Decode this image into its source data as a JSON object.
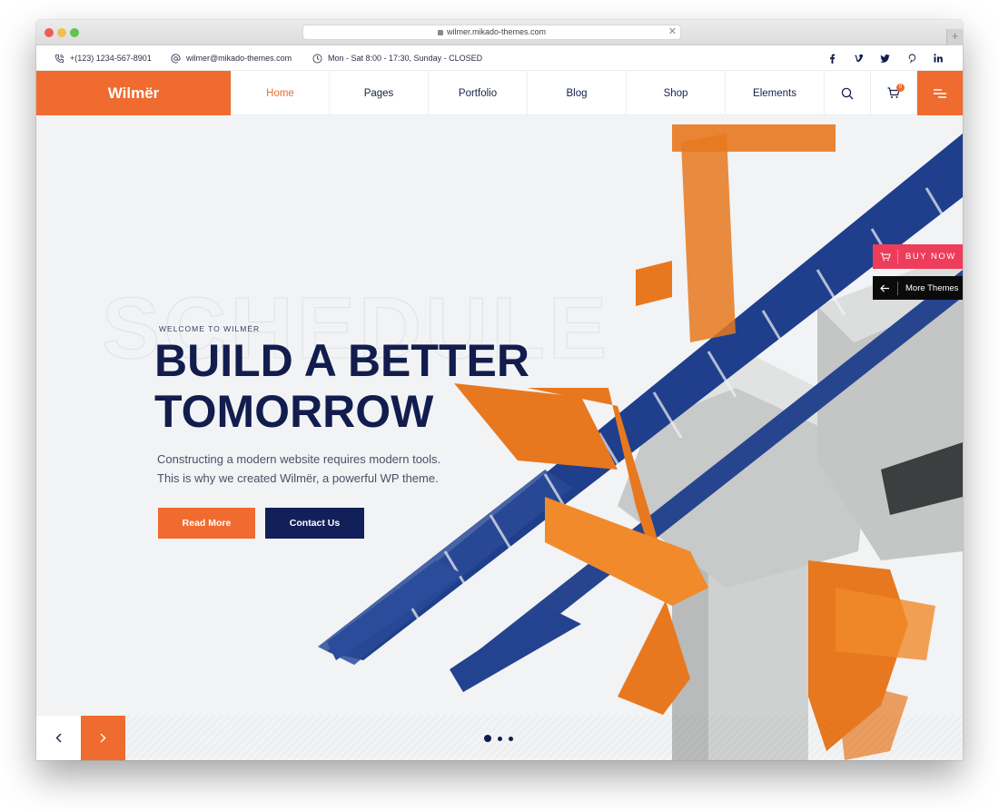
{
  "browser": {
    "url": "wilmer.mikado-themes.com",
    "new_tab_label": "+"
  },
  "topbar": {
    "phone": "+(123) 1234-567-8901",
    "email": "wilmer@mikado-themes.com",
    "hours": "Mon - Sat 8:00 - 17:30, Sunday - CLOSED",
    "social": [
      {
        "name": "facebook",
        "glyph": "f"
      },
      {
        "name": "vimeo",
        "glyph": "v"
      },
      {
        "name": "twitter",
        "glyph": "t"
      },
      {
        "name": "pinterest",
        "glyph": "p"
      },
      {
        "name": "linkedin",
        "glyph": "in"
      }
    ]
  },
  "nav": {
    "logo": "Wilmër",
    "items": [
      {
        "label": "Home",
        "active": true
      },
      {
        "label": "Pages"
      },
      {
        "label": "Portfolio"
      },
      {
        "label": "Blog"
      },
      {
        "label": "Shop"
      },
      {
        "label": "Elements"
      }
    ],
    "cart_count": "0"
  },
  "hero": {
    "background_word": "SCHEDULE",
    "eyebrow": "WELCOME TO WILMËR",
    "headline_line1": "BUILD A BETTER",
    "headline_line2": "TOMORROW",
    "sub_line1": "Constructing a modern website requires modern tools.",
    "sub_line2": "This is why we created Wilmër, a powerful WP theme.",
    "read_more": "Read More",
    "contact_us": "Contact Us",
    "slides": 3,
    "active_slide": 1
  },
  "side_buttons": {
    "buy_now": "BUY NOW",
    "more_themes": "More Themes"
  },
  "colors": {
    "accent": "#ef6b30",
    "navy": "#121d4e",
    "buy_now": "#ee3d5a",
    "steel_blue": "#1f3e8c",
    "crane_orange": "#e8781f"
  }
}
